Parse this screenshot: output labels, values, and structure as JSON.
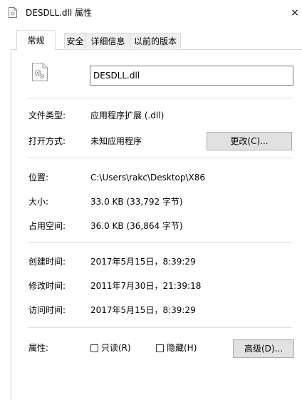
{
  "window": {
    "title": "DESDLL.dll 属性",
    "close_symbol": "×",
    "title_icon": "document-icon"
  },
  "tabs": [
    {
      "label": "常规",
      "active": true
    },
    {
      "label": "安全",
      "active": false
    },
    {
      "label": "详细信息",
      "active": false
    },
    {
      "label": "以前的版本",
      "active": false
    }
  ],
  "general": {
    "file_icon": "dll-gear-icon",
    "file_name": "DESDLL.dll",
    "file_type_label": "文件类型:",
    "file_type_value": "应用程序扩展 (.dll)",
    "open_with_label": "打开方式:",
    "open_with_value": "未知应用程序",
    "change_button": "更改(C)...",
    "location_label": "位置:",
    "location_value": "C:\\Users\\rakc\\Desktop\\X86",
    "size_label": "大小:",
    "size_value": "33.0 KB (33,792 字节)",
    "size_on_disk_label": "占用空间:",
    "size_on_disk_value": "36.0 KB (36,864 字节)",
    "created_label": "创建时间:",
    "created_value": "2017年5月15日，8:39:29",
    "modified_label": "修改时间:",
    "modified_value": "2011年7月30日，21:39:18",
    "accessed_label": "访问时间:",
    "accessed_value": "2017年5月15日，8:39:29",
    "attributes_label": "属性:",
    "readonly_label": "只读(R)",
    "readonly_checked": false,
    "hidden_label": "隐藏(H)",
    "hidden_checked": false,
    "advanced_button": "高级(D)..."
  }
}
